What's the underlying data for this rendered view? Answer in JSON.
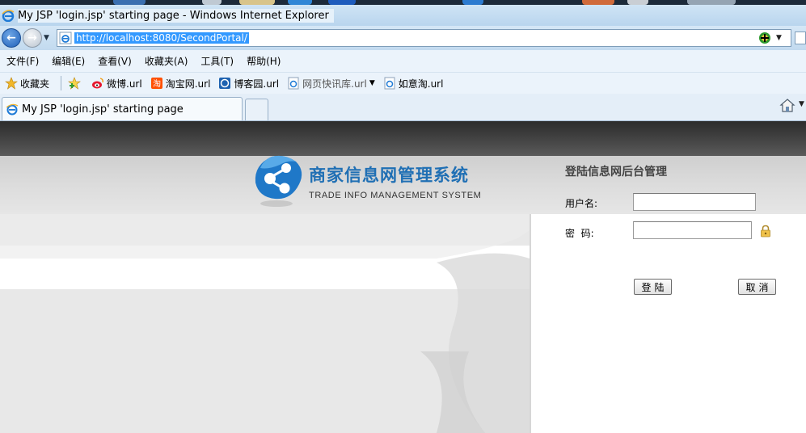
{
  "browser": {
    "window_title": "My JSP 'login.jsp' starting page - Windows Internet Explorer",
    "address_url": "http://localhost:8080/SecondPortal/",
    "menu": [
      "文件(F)",
      "编辑(E)",
      "查看(V)",
      "收藏夹(A)",
      "工具(T)",
      "帮助(H)"
    ],
    "favorites": {
      "label": "收藏夹",
      "items": [
        "微博.url",
        "淘宝网.url",
        "博客园.url",
        "网页快讯库.url",
        "如意淘.url"
      ]
    },
    "tab_title": "My JSP 'login.jsp' starting page"
  },
  "page": {
    "logo_title": "商家信息网管理系统",
    "logo_subtitle": "TRADE INFO MANAGEMENT SYSTEM",
    "login": {
      "title": "登陆信息网后台管理",
      "username_label": "用户名:",
      "password_label": "密  码:",
      "username_value": "",
      "password_value": "",
      "login_button": "登陆",
      "cancel_button": "取消"
    }
  },
  "colors": {
    "brand_blue": "#1f6fb4",
    "header_dark": "#3a3a3a",
    "url_highlight": "#3399ff"
  }
}
